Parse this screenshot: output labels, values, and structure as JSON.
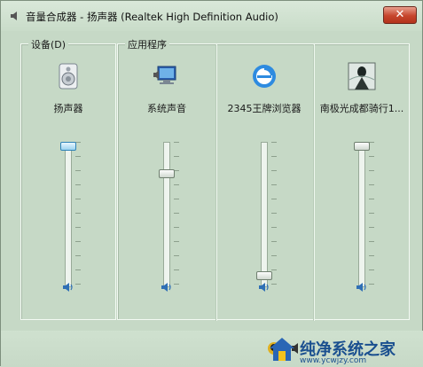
{
  "window": {
    "title": "音量合成器 - 扬声器 (Realtek High Definition Audio)",
    "close_label": "✕"
  },
  "device_group": {
    "label": "设备(D)",
    "channel": {
      "name": "扬声器",
      "icon": "speaker-device-icon",
      "level": 1.0
    }
  },
  "apps_group": {
    "label": "应用程序",
    "channels": [
      {
        "name": "系统声音",
        "icon": "system-sounds-icon",
        "level": 0.8
      },
      {
        "name": "2345王牌浏览器",
        "icon": "browser-e-icon",
        "level": 0.05
      },
      {
        "name": "南极光成都骑行1...",
        "icon": "app-thumbnail-icon",
        "level": 1.0
      }
    ]
  },
  "footer": {
    "watermark_text": "纯净系统之家",
    "watermark_url": "www.ycwjzy.com"
  },
  "colors": {
    "window_bg": "#c6d9c6",
    "close_red": "#c6452c",
    "watermark_blue": "#1a4f8f"
  }
}
